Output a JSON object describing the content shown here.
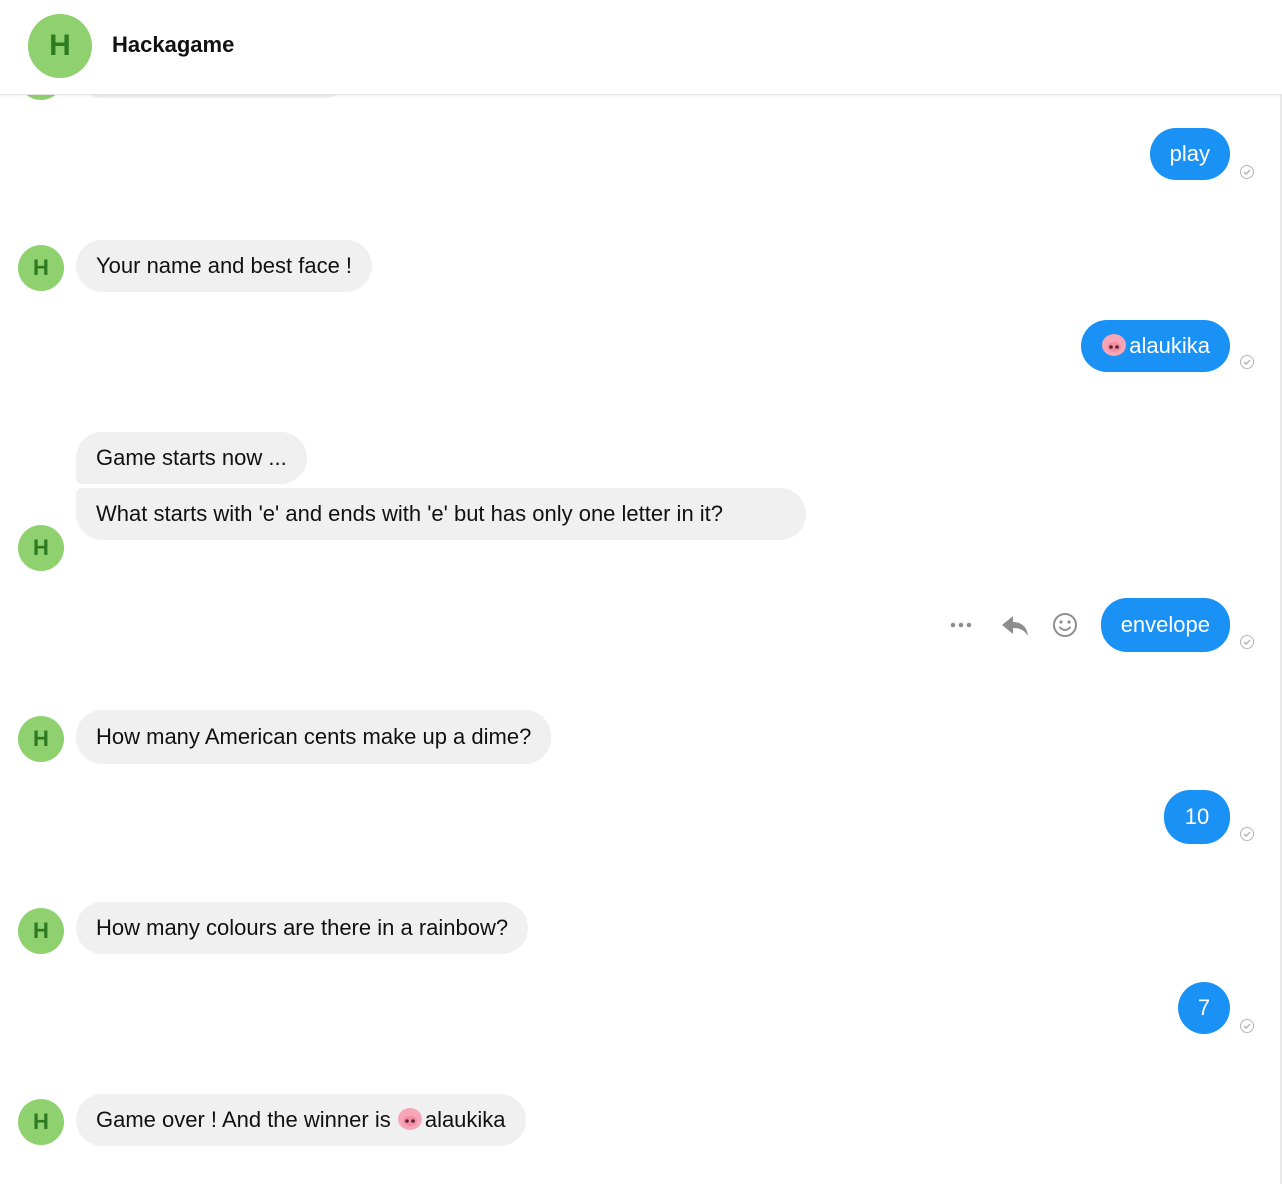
{
  "header": {
    "avatar_letter": "H",
    "title": "Hackagame"
  },
  "messages": [
    {
      "from": "bot",
      "text": "Your name and best face !"
    },
    {
      "from": "user",
      "text": "play"
    },
    {
      "from": "user",
      "text": "alaukika",
      "emoji": "pig-face-icon"
    },
    {
      "from": "bot",
      "text": "Game starts now ..."
    },
    {
      "from": "bot",
      "text": "What starts with 'e' and ends with 'e' but  has only one letter in it?"
    },
    {
      "from": "user",
      "text": "envelope"
    },
    {
      "from": "bot",
      "text": "How many American cents make up a dime?"
    },
    {
      "from": "user",
      "text": "10"
    },
    {
      "from": "bot",
      "text": "How many colours are there in a rainbow?"
    },
    {
      "from": "user",
      "text": "7"
    },
    {
      "from": "bot",
      "text_before": "Game over ! And the winner is",
      "text_after": "alaukika",
      "emoji": "pig-face-icon"
    }
  ],
  "avatar_letter": "H",
  "message_actions": [
    "more-options-icon",
    "reply-icon",
    "react-emoji-icon"
  ],
  "colors": {
    "user_bubble": "#1a91f5",
    "bot_bubble": "#f0f0f0",
    "avatar_bg": "#8fd16f",
    "avatar_text": "#2d7a22"
  }
}
